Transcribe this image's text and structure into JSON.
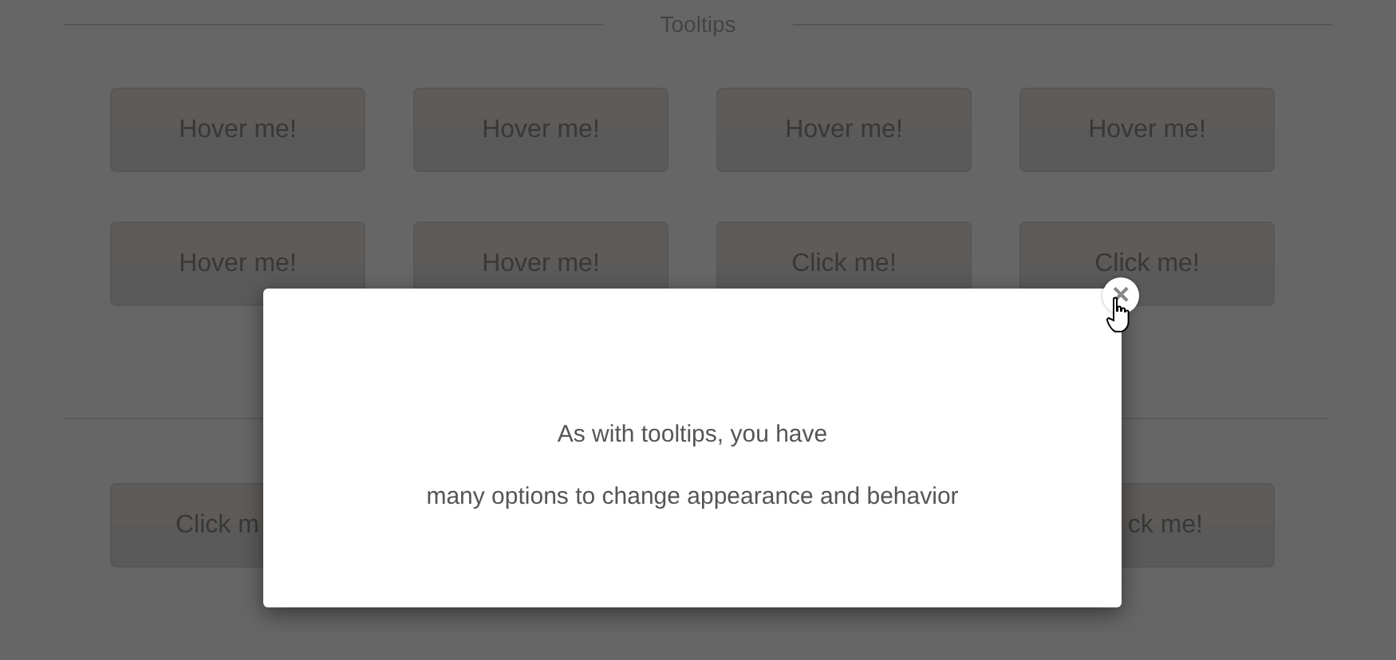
{
  "section": {
    "title": "Tooltips"
  },
  "button_rows": [
    [
      {
        "label": "Hover me!"
      },
      {
        "label": "Hover me!"
      },
      {
        "label": "Hover me!"
      },
      {
        "label": "Hover me!"
      }
    ],
    [
      {
        "label": "Hover me!"
      },
      {
        "label": "Hover me!"
      },
      {
        "label": "Click me!"
      },
      {
        "label": "Click me!"
      }
    ]
  ],
  "partly_hidden_row": {
    "left_button": {
      "label": "Click m"
    },
    "right_button": {
      "label": "ck me!"
    }
  },
  "modal": {
    "lines": [
      "As with tooltips, you have",
      "many options to change appearance and behavior"
    ],
    "close_label": "×"
  }
}
